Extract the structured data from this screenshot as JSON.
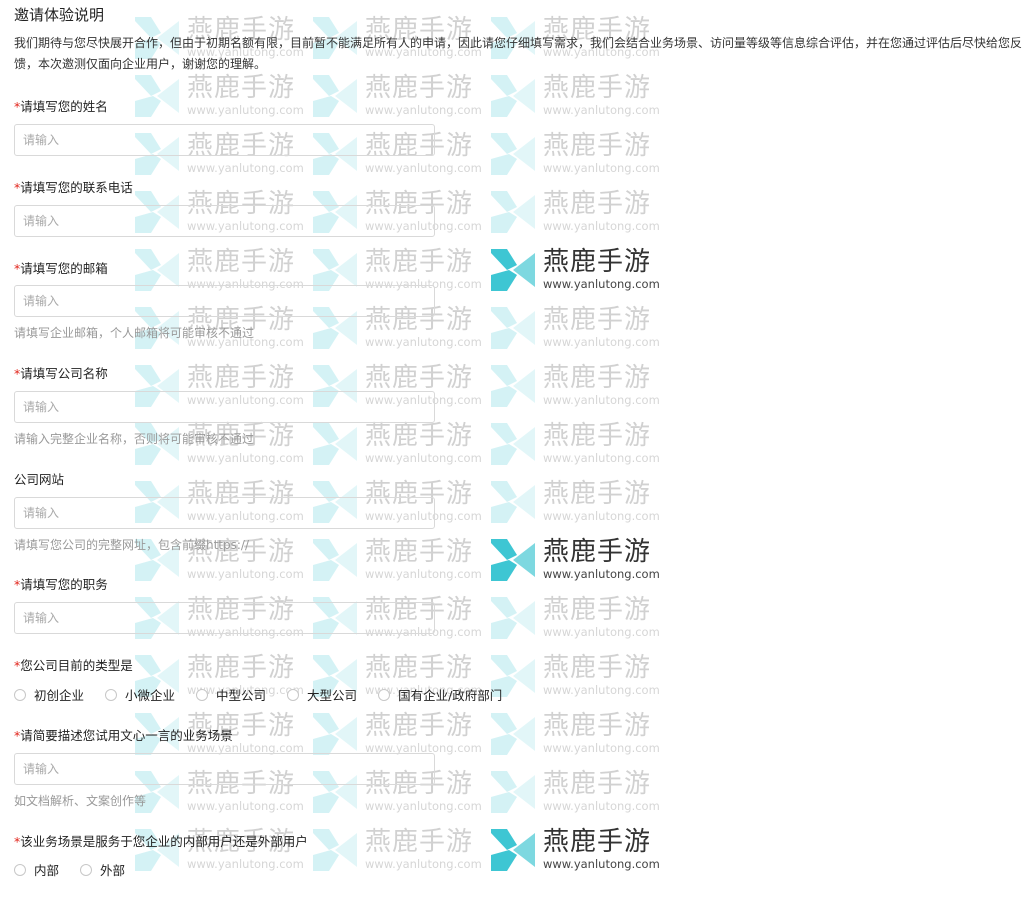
{
  "title": "邀请体验说明",
  "intro": "我们期待与您尽快展开合作，但由于初期名额有限，目前暂不能满足所有人的申请，因此请您仔细填写需求，我们会结合业务场景、访问量等级等信息综合评估，并在您通过评估后尽快给您反馈，本次邀测仅面向企业用户，谢谢您的理解。",
  "required_mark": "*",
  "input_placeholder": "请输入",
  "fields": [
    {
      "label": "请填写您的姓名",
      "required": true,
      "value": ""
    },
    {
      "label": "请填写您的联系电话",
      "required": true,
      "value": ""
    },
    {
      "label": "请填写您的邮箱",
      "required": true,
      "value": "",
      "hint": "请填写企业邮箱，个人邮箱将可能审核不通过"
    },
    {
      "label": "请填写公司名称",
      "required": true,
      "value": "",
      "hint": "请输入完整企业名称，否则将可能审核不通过"
    },
    {
      "label": "公司网站",
      "required": false,
      "value": "",
      "hint": "请填写您公司的完整网址，包含前缀https://"
    },
    {
      "label": "请填写您的职务",
      "required": true,
      "value": ""
    },
    {
      "label": "您公司目前的类型是",
      "required": true,
      "options": [
        "初创企业",
        "小微企业",
        "中型公司",
        "大型公司",
        "国有企业/政府部门"
      ]
    },
    {
      "label": "请简要描述您试用文心一言的业务场景",
      "required": true,
      "value": "",
      "hint": "如文档解析、文案创作等"
    },
    {
      "label": "该业务场景是服务于您企业的内部用户还是外部用户",
      "required": true,
      "options": [
        "内部",
        "外部"
      ]
    }
  ],
  "watermark": {
    "name": "燕鹿手游",
    "url": "www.yanlutong.com",
    "color_primary": "#3ec6d3",
    "color_secondary": "#7dd8e0"
  }
}
